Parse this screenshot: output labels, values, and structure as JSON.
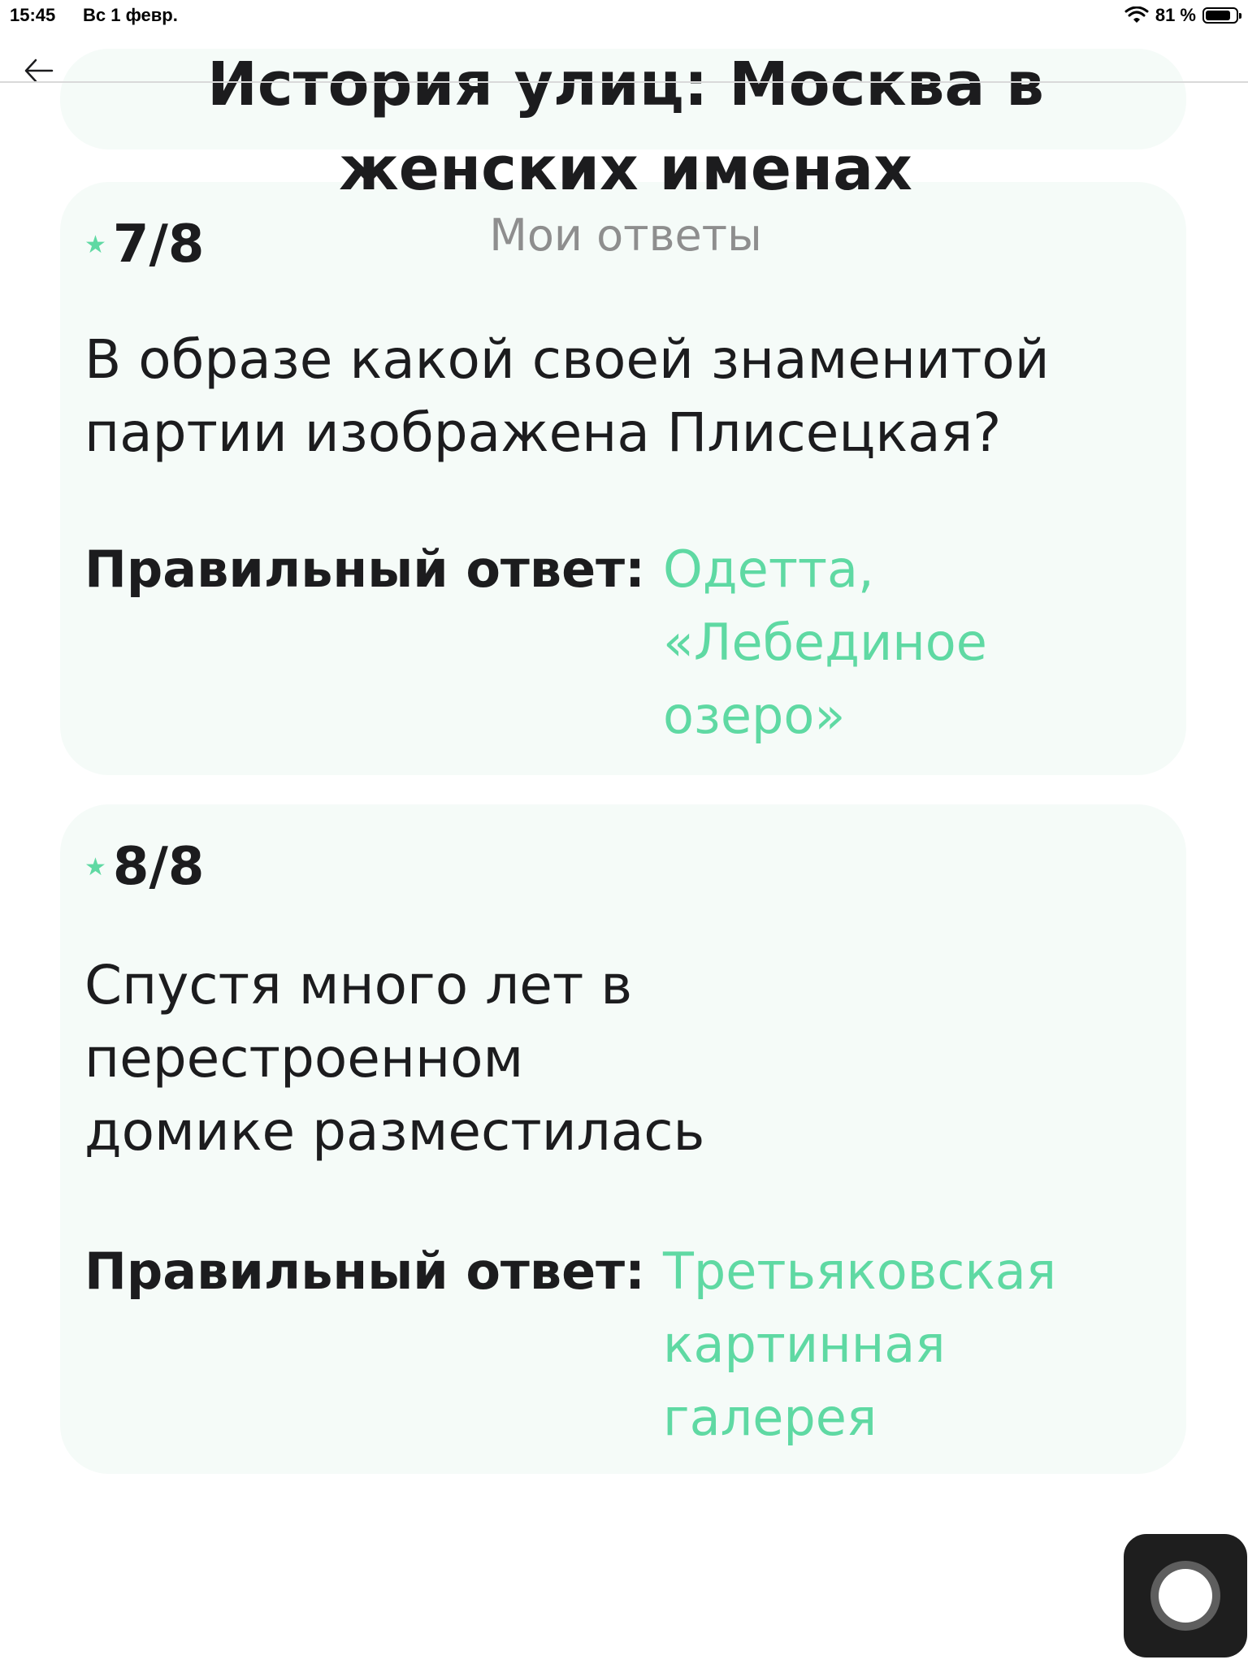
{
  "status_bar": {
    "time": "15:45",
    "date": "Вс 1 февр.",
    "battery": "81 %"
  },
  "header": {
    "title": "История улиц: Москва в женских именах",
    "subtitle": "Мои ответы"
  },
  "cards": [
    {
      "score": "7/8",
      "question": "В образе какой своей знаменитой партии изображена Плисецкая?",
      "answer_label": "Правильный ответ:",
      "answer": "Одетта, «Лебединое озеро»"
    },
    {
      "score": "8/8",
      "question": "Спустя много лет в перестроенном домике разместилась",
      "answer_label": "Правильный ответ:",
      "answer": "Третьяковская картинная галерея"
    }
  ],
  "colors": {
    "accent": "#5fd9a3",
    "card_bg": "#f5fbf8",
    "text": "#1c1c1e",
    "subtitle": "#8e8e8e"
  },
  "icons": {
    "back": "arrow-left-icon",
    "star": "star-icon",
    "wifi": "wifi-icon",
    "battery": "battery-icon",
    "assistive_touch": "assistive-touch-icon"
  }
}
